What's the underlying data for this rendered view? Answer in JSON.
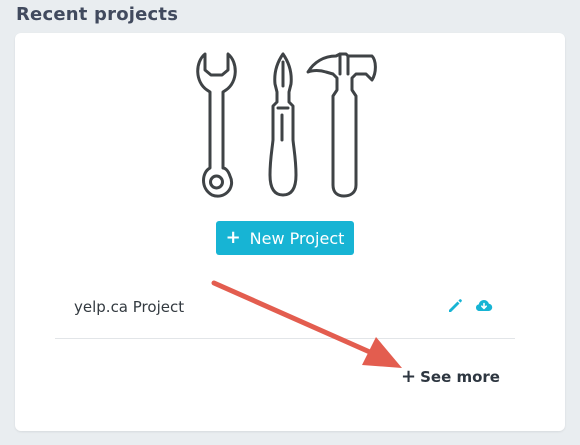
{
  "section": {
    "title": "Recent projects"
  },
  "illustration": {
    "icon": "tools-icon",
    "stroke_color": "#3f4346"
  },
  "new_project": {
    "label": "New Project",
    "plus": "+",
    "color": "#17b4d4"
  },
  "projects": [
    {
      "name": "yelp.ca Project",
      "actions": [
        "pencil-icon",
        "cloud-download-icon"
      ]
    }
  ],
  "see_more": {
    "plus": "+",
    "label": "See more"
  },
  "colors": {
    "background": "#e9edf0",
    "card": "#ffffff",
    "accent": "#17b4d4",
    "annotation_arrow": "#e35d4f"
  }
}
